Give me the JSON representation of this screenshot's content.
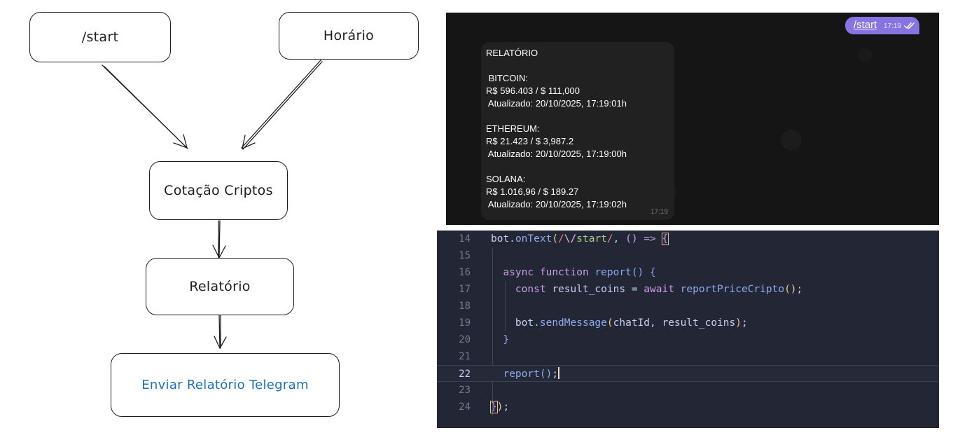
{
  "flowchart": {
    "nodes": {
      "start": "/start",
      "horario": "Horário",
      "cotacao": "Cotação Criptos",
      "relatorio": "Relatório",
      "enviar": "Enviar Relatório Telegram"
    }
  },
  "chat": {
    "outgoing": {
      "text": "/start",
      "time": "17:19",
      "status": "read-double-check-icon"
    },
    "incoming": {
      "time": "17:19",
      "lines": [
        "RELATÓRIO",
        "",
        " BITCOIN:",
        "R$ 596.403 / $ 111,000",
        " Atualizado: 20/10/2025, 17:19:01h",
        "",
        "ETHEREUM:",
        "R$ 21.423 / $ 3,987.2",
        " Atualizado: 20/10/2025, 17:19:00h",
        "",
        "SOLANA:",
        "R$ 1.016,96 / $ 189.27",
        " Atualizado: 20/10/2025, 17:19:02h"
      ]
    }
  },
  "code": {
    "line_numbers": [
      "14",
      "15",
      "16",
      "17",
      "18",
      "19",
      "20",
      "21",
      "22",
      "23",
      "24"
    ],
    "active_line": "22",
    "tokens": {
      "l14_bot": "bot",
      "l14_dot": ".",
      "l14_onText": "onText",
      "l14_p1": "(",
      "l14_rx1": "/",
      "l14_rxesc": "\\/",
      "l14_rxbody": "start",
      "l14_rx2": "/",
      "l14_comma": ",",
      "l14_p2": "()",
      "l14_arrow": "=>",
      "l14_brace": "{",
      "l16_async": "async",
      "l16_function": "function",
      "l16_name": "report",
      "l16_parens": "()",
      "l16_brace": "{",
      "l17_const": "const",
      "l17_var": "result_coins",
      "l17_eq": "=",
      "l17_await": "await",
      "l17_call": "reportPriceCripto",
      "l17_parens": "()",
      "l17_semi": ";",
      "l19_bot": "bot",
      "l19_dot": ".",
      "l19_send": "sendMessage",
      "l19_p1": "(",
      "l19_arg1": "chatId",
      "l19_comma": ",",
      "l19_arg2": "result_coins",
      "l19_p2": ")",
      "l19_semi": ";",
      "l20_brace": "}",
      "l22_call": "report",
      "l22_parens": "()",
      "l22_semi": ";",
      "l24_brace": "}",
      "l24_paren": ")",
      "l24_semi": ";"
    }
  },
  "colors": {
    "flow_text_blue": "#1971c2",
    "chat_outgoing_bubble": "#8774e1",
    "chat_incoming_bubble": "#212121",
    "editor_background": "#232634"
  }
}
